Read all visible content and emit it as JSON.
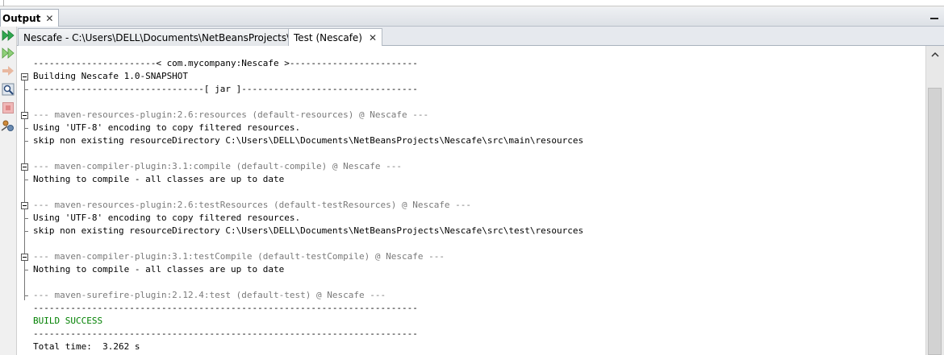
{
  "window": {
    "tab_title": "Output"
  },
  "subtabs": [
    {
      "label": "Nescafe - C:\\Users\\DELL\\Documents\\NetBeansProjects\\Nescafe",
      "active": false
    },
    {
      "label": "Test (Nescafe)",
      "active": true
    }
  ],
  "toolbar_icons": [
    "rerun-icon",
    "rerun-goals-icon",
    "stop-arrow-icon",
    "search-icon",
    "stop-icon",
    "settings-icon"
  ],
  "console": {
    "lines": [
      {
        "text": "-----------------------< com.mycompany:Nescafe >------------------------",
        "style": "normal"
      },
      {
        "text": "Building Nescafe 1.0-SNAPSHOT",
        "style": "normal"
      },
      {
        "text": "--------------------------------[ jar ]---------------------------------",
        "style": "normal"
      },
      {
        "text": "",
        "style": "normal"
      },
      {
        "text": "--- maven-resources-plugin:2.6:resources (default-resources) @ Nescafe ---",
        "style": "gray"
      },
      {
        "text": "Using 'UTF-8' encoding to copy filtered resources.",
        "style": "normal"
      },
      {
        "text": "skip non existing resourceDirectory C:\\Users\\DELL\\Documents\\NetBeansProjects\\Nescafe\\src\\main\\resources",
        "style": "normal"
      },
      {
        "text": "",
        "style": "normal"
      },
      {
        "text": "--- maven-compiler-plugin:3.1:compile (default-compile) @ Nescafe ---",
        "style": "gray"
      },
      {
        "text": "Nothing to compile - all classes are up to date",
        "style": "normal"
      },
      {
        "text": "",
        "style": "normal"
      },
      {
        "text": "--- maven-resources-plugin:2.6:testResources (default-testResources) @ Nescafe ---",
        "style": "gray"
      },
      {
        "text": "Using 'UTF-8' encoding to copy filtered resources.",
        "style": "normal"
      },
      {
        "text": "skip non existing resourceDirectory C:\\Users\\DELL\\Documents\\NetBeansProjects\\Nescafe\\src\\test\\resources",
        "style": "normal"
      },
      {
        "text": "",
        "style": "normal"
      },
      {
        "text": "--- maven-compiler-plugin:3.1:testCompile (default-testCompile) @ Nescafe ---",
        "style": "gray"
      },
      {
        "text": "Nothing to compile - all classes are up to date",
        "style": "normal"
      },
      {
        "text": "",
        "style": "normal"
      },
      {
        "text": "--- maven-surefire-plugin:2.12.4:test (default-test) @ Nescafe ---",
        "style": "gray"
      },
      {
        "text": "------------------------------------------------------------------------",
        "style": "normal"
      },
      {
        "text": "BUILD SUCCESS",
        "style": "green"
      },
      {
        "text": "------------------------------------------------------------------------",
        "style": "normal"
      },
      {
        "text": "Total time:  3.262 s",
        "style": "normal"
      }
    ]
  },
  "colors": {
    "success": "#008000",
    "plugin_header": "#7a7a7a",
    "run_icon": "#2fa84f"
  }
}
